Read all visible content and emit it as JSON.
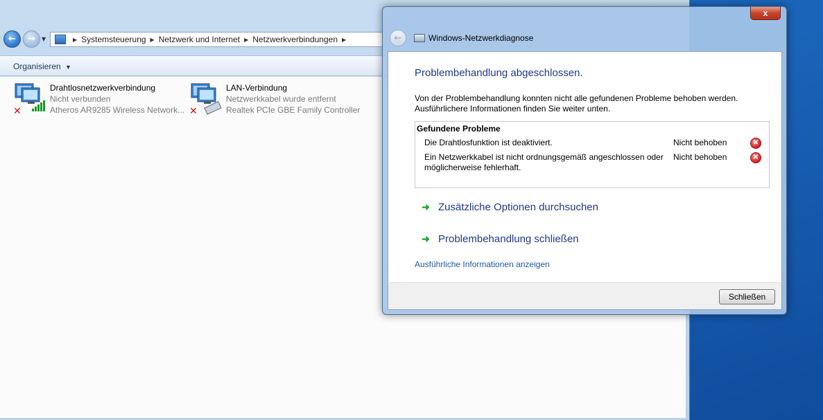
{
  "explorer": {
    "breadcrumbs": [
      "Systemsteuerung",
      "Netzwerk und Internet",
      "Netzwerkverbindungen"
    ],
    "organize_label": "Organisieren",
    "connections": [
      {
        "name": "Drahtlosnetzwerkverbindung",
        "status": "Nicht verbunden",
        "adapter": "Atheros AR9285 Wireless Network...",
        "icon": "wireless-network-icon"
      },
      {
        "name": "LAN-Verbindung",
        "status": "Netzwerkkabel wurde entfernt",
        "adapter": "Realtek PCIe GBE Family Controller",
        "icon": "lan-network-icon"
      }
    ]
  },
  "dialog": {
    "title": "Windows-Netzwerkdiagnose",
    "close_glyph": "x",
    "heading": "Problembehandlung abgeschlossen.",
    "description": "Von der Problembehandlung konnten nicht alle gefundenen Probleme behoben werden. Ausführlichere Informationen finden Sie weiter unten.",
    "problems_title": "Gefundene Probleme",
    "problems": [
      {
        "text": "Die Drahtlosfunktion ist deaktiviert.",
        "status": "Nicht behoben"
      },
      {
        "text": "Ein Netzwerkkabel ist nicht ordnungsgemäß angeschlossen oder möglicherweise fehlerhaft.",
        "status": "Nicht behoben"
      }
    ],
    "options": [
      {
        "label": "Zusätzliche Optionen durchsuchen"
      },
      {
        "label": "Problembehandlung schließen"
      }
    ],
    "details_link": "Ausführliche Informationen anzeigen",
    "close_button": "Schließen"
  },
  "colors": {
    "link_blue": "#1e3a8a",
    "error_red": "#cc2222",
    "arrow_green": "#1aa62a",
    "desktop_blue": "#1a64b9"
  }
}
